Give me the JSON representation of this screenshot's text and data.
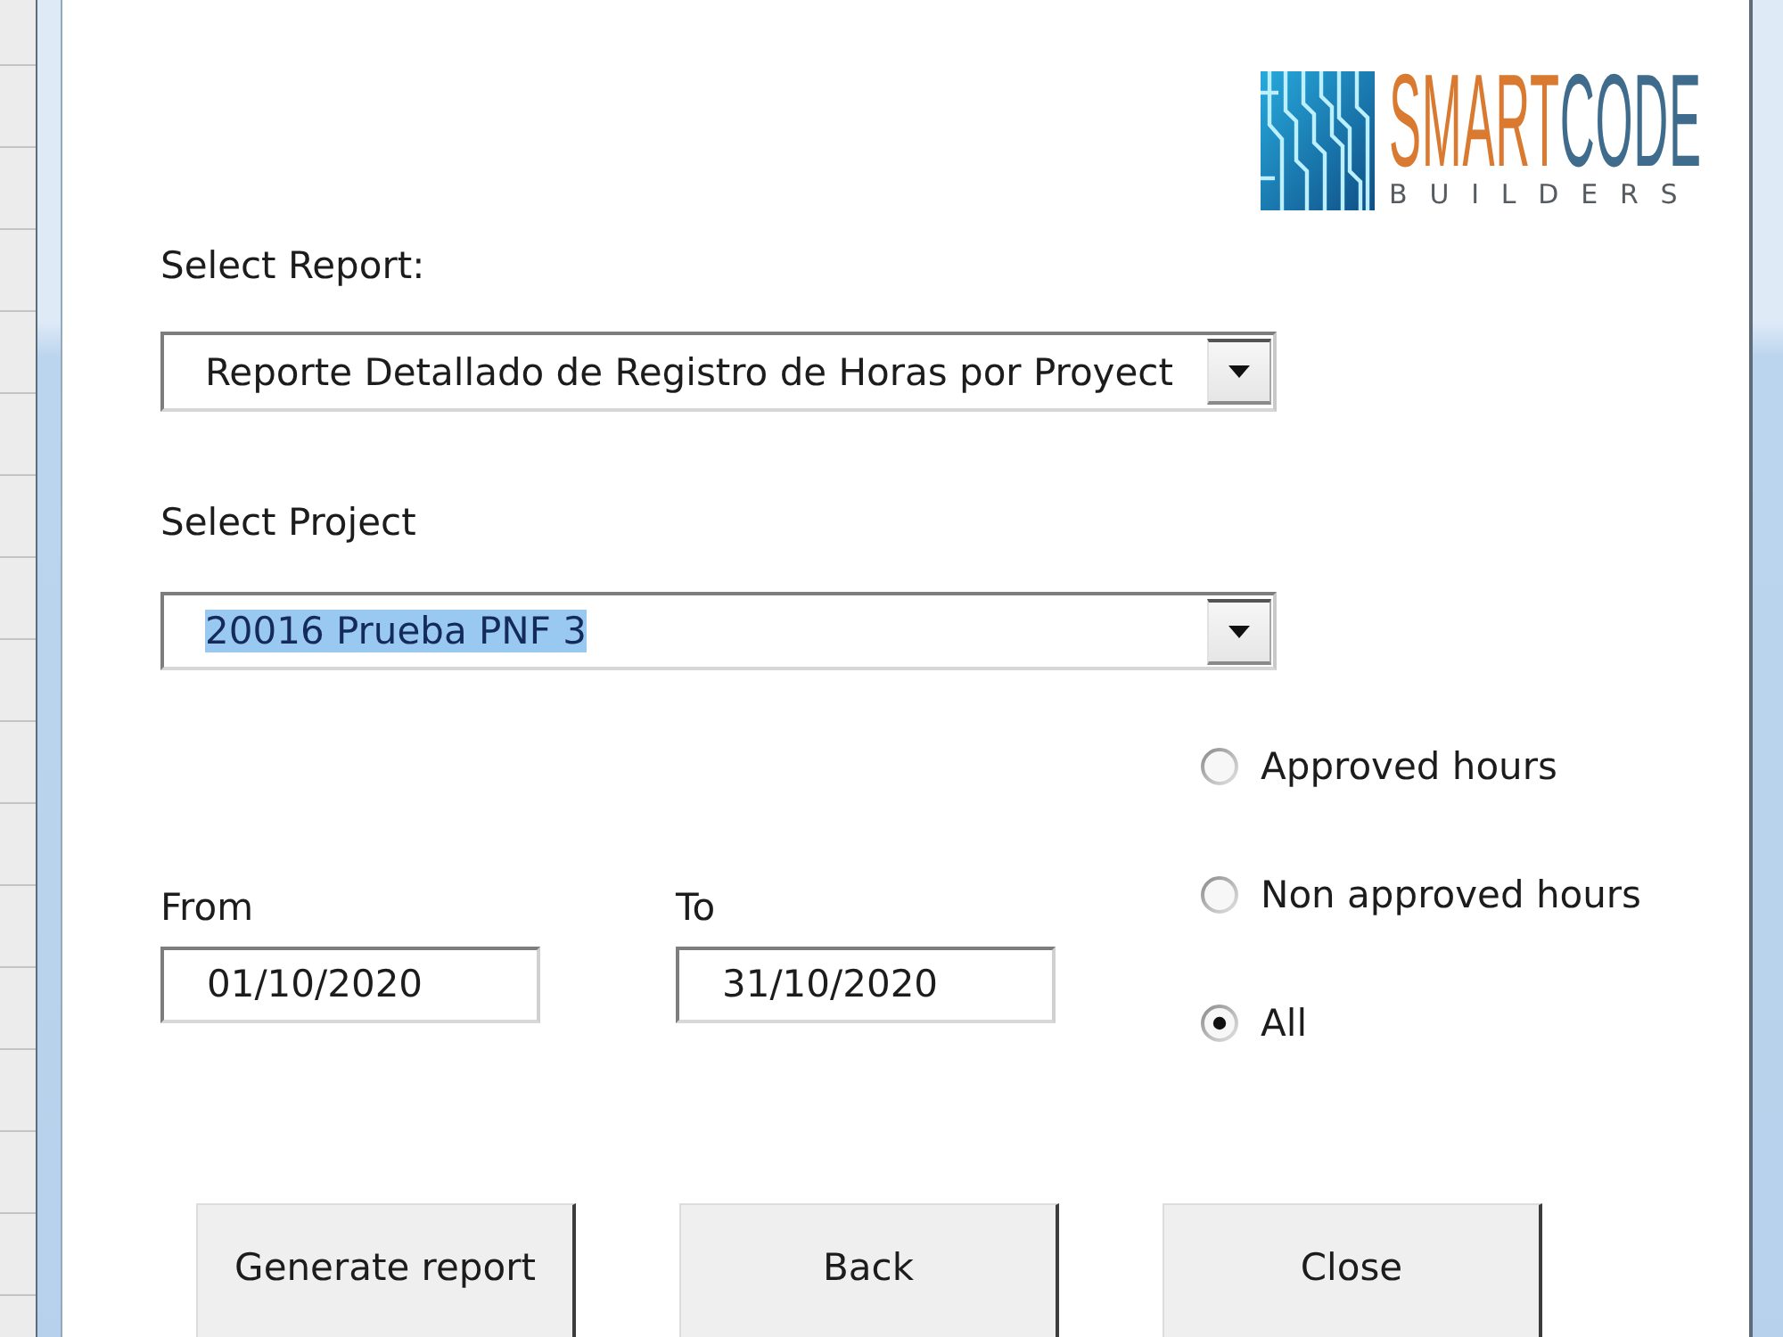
{
  "logo": {
    "wordmark": [
      {
        "text": "SMART",
        "color": "#d97a30"
      },
      {
        "text": "CODE",
        "color": "#3f6b8c"
      }
    ],
    "tagline": "BUILDERS"
  },
  "selects": [
    {
      "label": "Select Report:",
      "value": "Reporte Detallado de Registro de Horas por Proyect",
      "highlighted": false
    },
    {
      "label": "Select Project",
      "value": "20016 Prueba PNF 3",
      "highlighted": true
    }
  ],
  "date_range": [
    {
      "label": "From",
      "value": "01/10/2020"
    },
    {
      "label": "To",
      "value": "31/10/2020"
    }
  ],
  "hours_filter": [
    {
      "label": "Approved hours",
      "selected": false
    },
    {
      "label": "Non approved hours",
      "selected": false
    },
    {
      "label": "All",
      "selected": true
    }
  ],
  "buttons": [
    "Generate report",
    "Back",
    "Close"
  ]
}
